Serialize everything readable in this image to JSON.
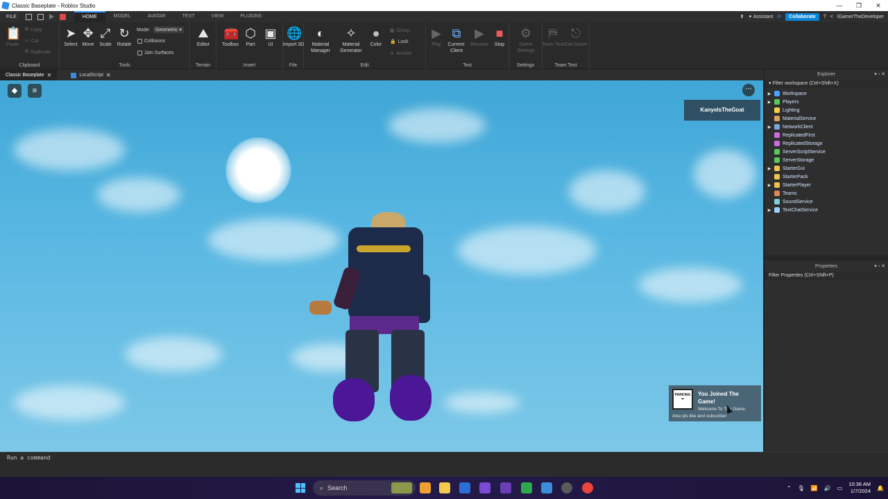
{
  "window": {
    "title": "Classic Baseplate - Roblox Studio",
    "controls": [
      "—",
      "❐",
      "✕"
    ]
  },
  "menubar": {
    "file": "FILE",
    "tabs": [
      "HOME",
      "MODEL",
      "AVATAR",
      "TEST",
      "VIEW",
      "PLUGINS"
    ],
    "assistant": "Assistant",
    "collaborate": "Collaborate",
    "username": "IGamerTheDeveloper"
  },
  "ribbon": {
    "clipboard": {
      "name": "Clipboard",
      "paste": "Paste",
      "copy": "Copy",
      "cut": "Cut",
      "duplicate": "Duplicate"
    },
    "tools": {
      "name": "Tools",
      "select": "Select",
      "move": "Move",
      "scale": "Scale",
      "rotate": "Rotate",
      "mode_label": "Mode:",
      "mode_value": "Geometric",
      "collisions": "Collisions",
      "join_surfaces": "Join Surfaces"
    },
    "terrain": {
      "name": "Terrain",
      "editor": "Editor"
    },
    "insert": {
      "name": "Insert",
      "toolbox": "Toolbox",
      "part": "Part",
      "ui": "UI"
    },
    "file": {
      "name": "File",
      "import3d": "Import 3D"
    },
    "edit": {
      "name": "Edit",
      "material_manager": "Material Manager",
      "material_generator": "Material Generator",
      "color": "Color",
      "group": "Group",
      "lock": "Lock",
      "anchor": "Anchor"
    },
    "test": {
      "name": "Test",
      "play": "Play",
      "current_client": "Current: Client",
      "resume": "Resume",
      "stop": "Stop"
    },
    "settings": {
      "name": "Settings",
      "game_settings": "Game Settings"
    },
    "team_test": {
      "name": "Team Test",
      "team_test": "Team Test",
      "exit_game": "Exit Game"
    }
  },
  "doc_tabs": [
    {
      "label": "Classic Baseplate"
    },
    {
      "label": "LocalScript"
    }
  ],
  "viewport": {
    "player_name": "KanyeIsTheGoat",
    "notification": {
      "badge": "PARKING",
      "title": "You Joined The Game!",
      "line1": "Welcome To The Game.",
      "line2": "Also pls like and subscribe!"
    }
  },
  "explorer": {
    "title": "Explorer",
    "filter": "Filter workspace (Ctrl+Shift+X)",
    "items": [
      {
        "label": "Workspace",
        "expandable": true,
        "color": "#4aa3ff"
      },
      {
        "label": "Players",
        "expandable": true,
        "color": "#5ac85a"
      },
      {
        "label": "Lighting",
        "expandable": false,
        "color": "#f4d03f"
      },
      {
        "label": "MaterialService",
        "expandable": false,
        "color": "#d9a35a"
      },
      {
        "label": "NetworkClient",
        "expandable": true,
        "color": "#7aa6d8"
      },
      {
        "label": "ReplicatedFirst",
        "expandable": false,
        "color": "#c96de0"
      },
      {
        "label": "ReplicatedStorage",
        "expandable": false,
        "color": "#c96de0"
      },
      {
        "label": "ServerScriptService",
        "expandable": false,
        "color": "#5ac85a"
      },
      {
        "label": "ServerStorage",
        "expandable": false,
        "color": "#5ac85a"
      },
      {
        "label": "StarterGui",
        "expandable": true,
        "color": "#f0c14b"
      },
      {
        "label": "StarterPack",
        "expandable": false,
        "color": "#f0c14b"
      },
      {
        "label": "StarterPlayer",
        "expandable": true,
        "color": "#f0c14b"
      },
      {
        "label": "Teams",
        "expandable": false,
        "color": "#d98a5a"
      },
      {
        "label": "SoundService",
        "expandable": false,
        "color": "#7ad1e0"
      },
      {
        "label": "TextChatService",
        "expandable": true,
        "color": "#9ad0ff"
      }
    ]
  },
  "properties": {
    "title": "Properties",
    "filter": "Filter Properties (Ctrl+Shift+P)"
  },
  "command_bar": {
    "placeholder": "Run a command"
  },
  "taskbar": {
    "search": "Search",
    "time": "10:36 AM",
    "date": "1/7/2024"
  }
}
